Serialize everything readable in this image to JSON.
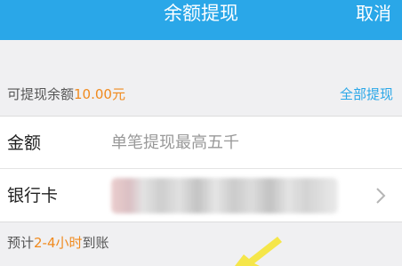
{
  "header": {
    "title": "余额提现",
    "cancel_label": "取消"
  },
  "balance": {
    "label": "可提现余额",
    "amount": "10.00元",
    "withdraw_all_label": "全部提现"
  },
  "amount_field": {
    "label": "金额",
    "placeholder": "单笔提现最高五千"
  },
  "bank_card": {
    "label": "银行卡",
    "chevron_icon": "chevron-right-icon"
  },
  "eta": {
    "prefix": "预计",
    "hours": "2-4小时",
    "suffix": "到账"
  },
  "colors": {
    "accent": "#2aa7e8",
    "highlight": "#f08a1e",
    "arrow": "#f5e64a"
  }
}
